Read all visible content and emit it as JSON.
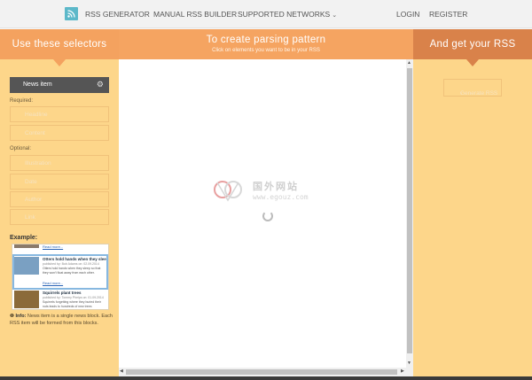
{
  "nav": {
    "brand": "RSS GENERATOR",
    "links": [
      "MANUAL RSS BUILDER",
      "SUPPORTED NETWORKS"
    ],
    "dropdown_caret": "⌄",
    "login": "LOGIN",
    "register": "REGISTER"
  },
  "left": {
    "title": "Use these selectors",
    "news_item": "News item",
    "required_label": "Required:",
    "required": [
      "Headline",
      "Content"
    ],
    "optional_label": "Optional:",
    "optional": [
      "Illustration",
      "Date",
      "Author",
      "Link"
    ],
    "example_label": "Example:",
    "example": {
      "top_more": "Read more...",
      "item1_title": "Otters hold hands when they sleep",
      "item1_meta": "published by: Bob Adams on: 02.09.2014",
      "item1_desc": "Otters hold hands when they sleep so that they won't float away from each other.",
      "item1_more": "Read more...",
      "item2_title": "Squirrels plant trees",
      "item2_meta": "published by: Tommy Phelps on: 01.09.2014",
      "item2_desc": "Squirrels forgetting where they buried their nuts leads to hundreds of new trees"
    },
    "info_label": "Info:",
    "info_text": "News item is a single news block. Each RSS item will be formed from this blocks."
  },
  "middle": {
    "title": "To create parsing pattern",
    "subtitle": "Click on elements you want to be in your RSS",
    "watermark_cn": "国外网站",
    "watermark_url": "www.egouz.com"
  },
  "right": {
    "title": "And get your RSS",
    "generate_button": "Generate RSS",
    "generate_arrow": "›"
  },
  "colors": {
    "accent_orange": "#f4a25f",
    "panel_yellow": "#fdd68a",
    "logo_teal": "#5cb8c9"
  }
}
